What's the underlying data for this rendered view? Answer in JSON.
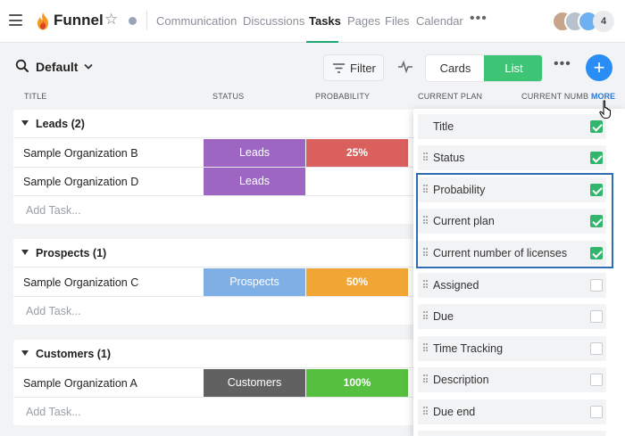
{
  "project": {
    "title": "Funnel"
  },
  "nav": {
    "tabs": [
      "Communication",
      "Discussions",
      "Tasks",
      "Pages",
      "Files",
      "Calendar"
    ],
    "active": "Tasks"
  },
  "members": {
    "extra_count": "4"
  },
  "toolbar": {
    "view_name": "Default",
    "filter_label": "Filter",
    "view_cards": "Cards",
    "view_list": "List"
  },
  "columns": {
    "title": "TITLE",
    "status": "STATUS",
    "probability": "PROBABILITY",
    "current_plan": "CURRENT PLAN",
    "current_number": "CURRENT NUMBEF",
    "more": "MORE"
  },
  "groups": [
    {
      "title": "Leads (2)",
      "rows": [
        {
          "name": "Sample Organization B",
          "status": "Leads",
          "probability": "25%"
        },
        {
          "name": "Sample Organization D",
          "status": "Leads",
          "probability": ""
        }
      ],
      "add_label": "Add Task..."
    },
    {
      "title": "Prospects (1)",
      "rows": [
        {
          "name": "Sample Organization C",
          "status": "Prospects",
          "probability": "50%"
        }
      ],
      "add_label": "Add Task..."
    },
    {
      "title": "Customers (1)",
      "rows": [
        {
          "name": "Sample Organization A",
          "status": "Customers",
          "probability": "100%"
        }
      ],
      "add_label": "Add Task..."
    }
  ],
  "colors": {
    "accent": "#3dc474",
    "status_leads": "#9d66c2",
    "status_prospects": "#7eb0e6",
    "status_customers": "#616161",
    "prob_25": "#d9605c",
    "prob_50": "#f0a535",
    "prob_100": "#56bf3f"
  },
  "columns_menu": [
    {
      "label": "Title",
      "checked": true
    },
    {
      "label": "Status",
      "checked": true
    },
    {
      "label": "Probability",
      "checked": true
    },
    {
      "label": "Current plan",
      "checked": true
    },
    {
      "label": "Current number of licenses",
      "checked": true
    },
    {
      "label": "Assigned",
      "checked": false
    },
    {
      "label": "Due",
      "checked": false
    },
    {
      "label": "Time Tracking",
      "checked": false
    },
    {
      "label": "Description",
      "checked": false
    },
    {
      "label": "Due end",
      "checked": false
    }
  ]
}
